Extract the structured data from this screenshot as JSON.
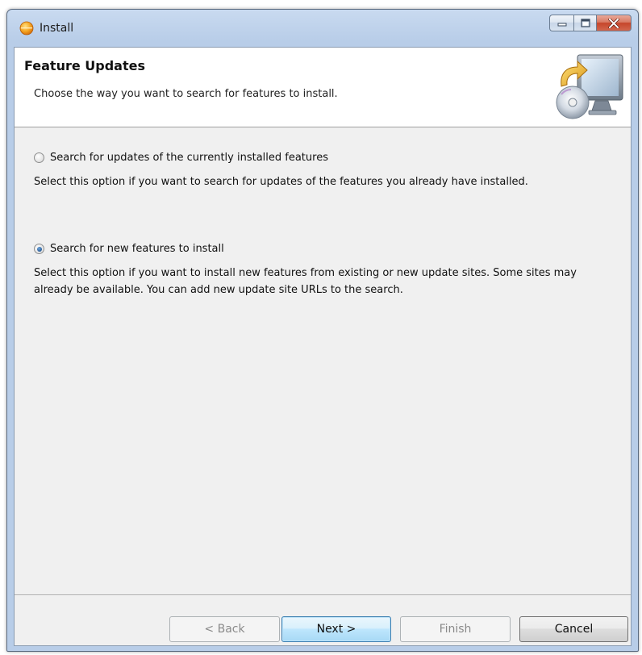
{
  "window": {
    "title": "Install",
    "icon": "eclipse-sun-icon"
  },
  "caption_buttons": {
    "minimize_icon": "minimize-icon",
    "maximize_icon": "maximize-icon",
    "close_icon": "close-icon"
  },
  "banner": {
    "title": "Feature Updates",
    "description": "Choose the way you want to search for features to install.",
    "image_icon": "computer-install-icon"
  },
  "options": [
    {
      "label": "Search for updates of the currently installed features",
      "description": "Select this option if you want to search for updates of the features you already have installed.",
      "checked": false
    },
    {
      "label": "Search for new features to install",
      "description": "Select this option if you want to install new features from existing or new update sites. Some sites may already be available. You can add new update site URLs to the search.",
      "checked": true
    }
  ],
  "buttons": {
    "back": "< Back",
    "next": "Next >",
    "finish": "Finish",
    "cancel": "Cancel"
  },
  "colors": {
    "title_bar": "#bcd0ea",
    "client_bg": "#f0f0f0",
    "default_button": "#bee6fd",
    "close_button": "#c6462b"
  }
}
